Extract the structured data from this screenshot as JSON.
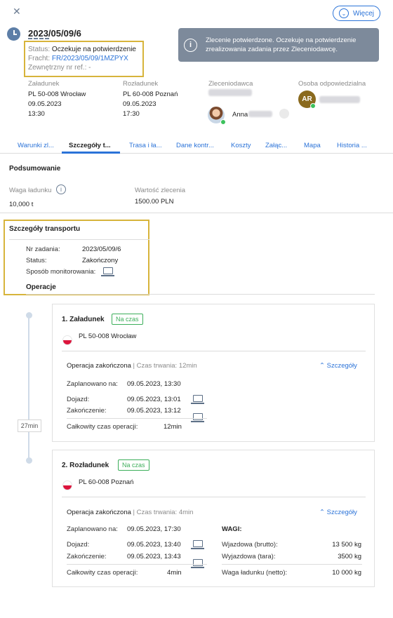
{
  "header": {
    "close_icon": "close-icon",
    "more_label": "Więcej",
    "order_number": "2023/05/09/6",
    "status_label": "Status:",
    "status_value": "Oczekuje na potwierdzenie",
    "fracht_label": "Fracht:",
    "fracht_value": "FR/2023/05/09/1MZPYX",
    "external_ref_label": "Zewnętrzny nr ref.:",
    "external_ref_value": "-",
    "info_message": "Zlecenie potwierdzone. Oczekuje na potwierdzenie zrealizowania zadania przez Zleceniodawcę."
  },
  "parties": {
    "loading_label": "Załadunek",
    "loading_address": "PL 50-008 Wrocław",
    "loading_date": "09.05.2023",
    "loading_time": "13:30",
    "unloading_label": "Rozładunek",
    "unloading_address": "PL 60-008 Poznań",
    "unloading_date": "09.05.2023",
    "unloading_time": "17:30",
    "client_label": "Zleceniodawca",
    "client_contact": "Anna",
    "responsible_label": "Osoba odpowiedzialna",
    "responsible_initials": "AR"
  },
  "tabs": [
    {
      "label": "Warunki zl..."
    },
    {
      "label": "Szczegóły t..."
    },
    {
      "label": "Trasa i ła..."
    },
    {
      "label": "Dane kontr..."
    },
    {
      "label": "Koszty"
    },
    {
      "label": "Załąc..."
    },
    {
      "label": "Mapa"
    },
    {
      "label": "Historia ..."
    }
  ],
  "summary": {
    "title": "Podsumowanie",
    "weight_label": "Waga ładunku",
    "weight_value": "10,000 t",
    "value_label": "Wartość zlecenia",
    "value_value": "1500.00 PLN"
  },
  "transport": {
    "title": "Szczegóły transportu",
    "task_no_label": "Nr zadania:",
    "task_no_value": "2023/05/09/6",
    "status_label": "Status:",
    "status_value": "Zakończony",
    "monitoring_label": "Sposób monitorowania:",
    "operations_title": "Operacje"
  },
  "timeline": {
    "duration": "27min"
  },
  "operations": [
    {
      "title": "1. Załadunek",
      "badge": "Na czas",
      "address": "PL 50-008 Wrocław",
      "state": "Operacja zakończona",
      "duration_text": "Czas trwania: 12min",
      "details_label": "Szczegóły",
      "planned_label": "Zaplanowano na:",
      "planned_value": "09.05.2023, 13:30",
      "arrival_label": "Dojazd:",
      "arrival_value": "09.05.2023, 13:01",
      "end_label": "Zakończenie:",
      "end_value": "09.05.2023, 13:12",
      "total_label": "Całkowity czas operacji:",
      "total_value": "12min"
    },
    {
      "title": "2. Rozładunek",
      "badge": "Na czas",
      "address": "PL 60-008 Poznań",
      "state": "Operacja zakończona",
      "duration_text": "Czas trwania: 4min",
      "details_label": "Szczegóły",
      "planned_label": "Zaplanowano na:",
      "planned_value": "09.05.2023, 17:30",
      "arrival_label": "Dojazd:",
      "arrival_value": "09.05.2023, 13:40",
      "end_label": "Zakończenie:",
      "end_value": "09.05.2023, 13:43",
      "total_label": "Całkowity czas operacji:",
      "total_value": "4min",
      "weights_title": "WAGI:",
      "gross_label": "Wjazdowa (brutto):",
      "gross_value": "13 500 kg",
      "tare_label": "Wyjazdowa (tara):",
      "tare_value": "3500 kg",
      "net_label": "Waga ładunku (netto):",
      "net_value": "10 000 kg"
    }
  ],
  "colors": {
    "accent": "#2b73d8",
    "highlight": "#d7b43b",
    "success": "#3cae5a",
    "info_bg": "#7d8a9b"
  }
}
